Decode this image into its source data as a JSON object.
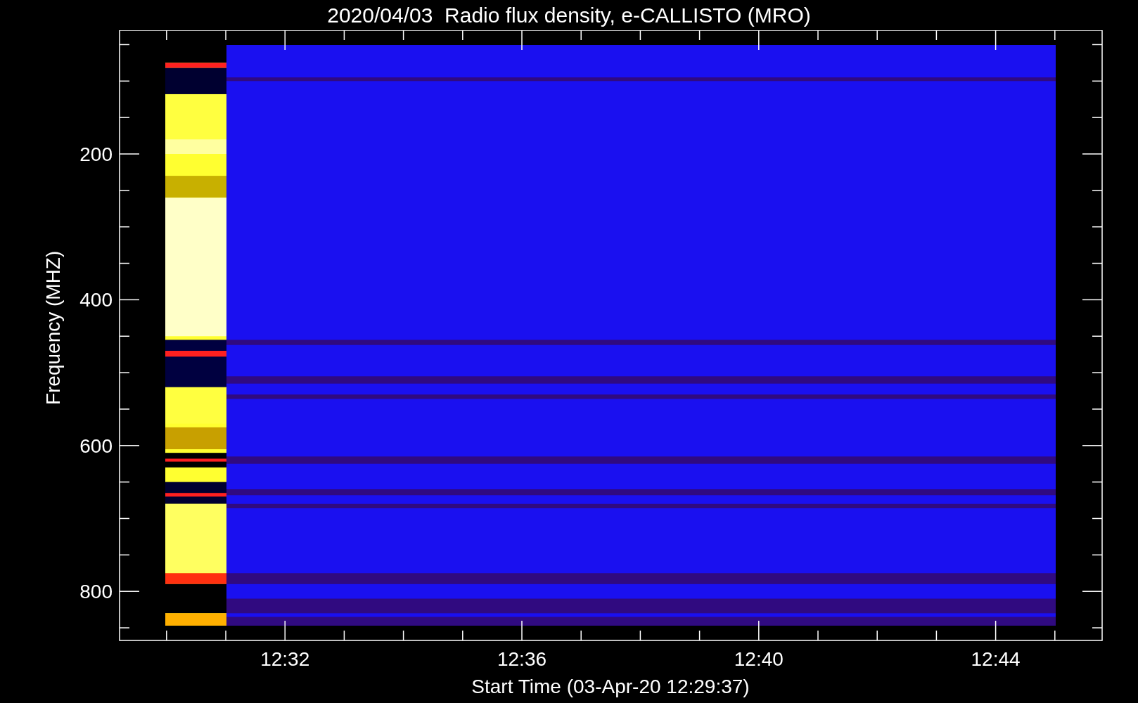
{
  "title": "2020/04/03  Radio flux density, e-CALLISTO (MRO)",
  "ylabel": "Frequency (MHZ)",
  "xlabel": "Start Time (03-Apr-20 12:29:37)",
  "yticks": [
    "200",
    "400",
    "600",
    "800"
  ],
  "xticks": [
    "12:32",
    "12:36",
    "12:40",
    "12:44"
  ]
}
